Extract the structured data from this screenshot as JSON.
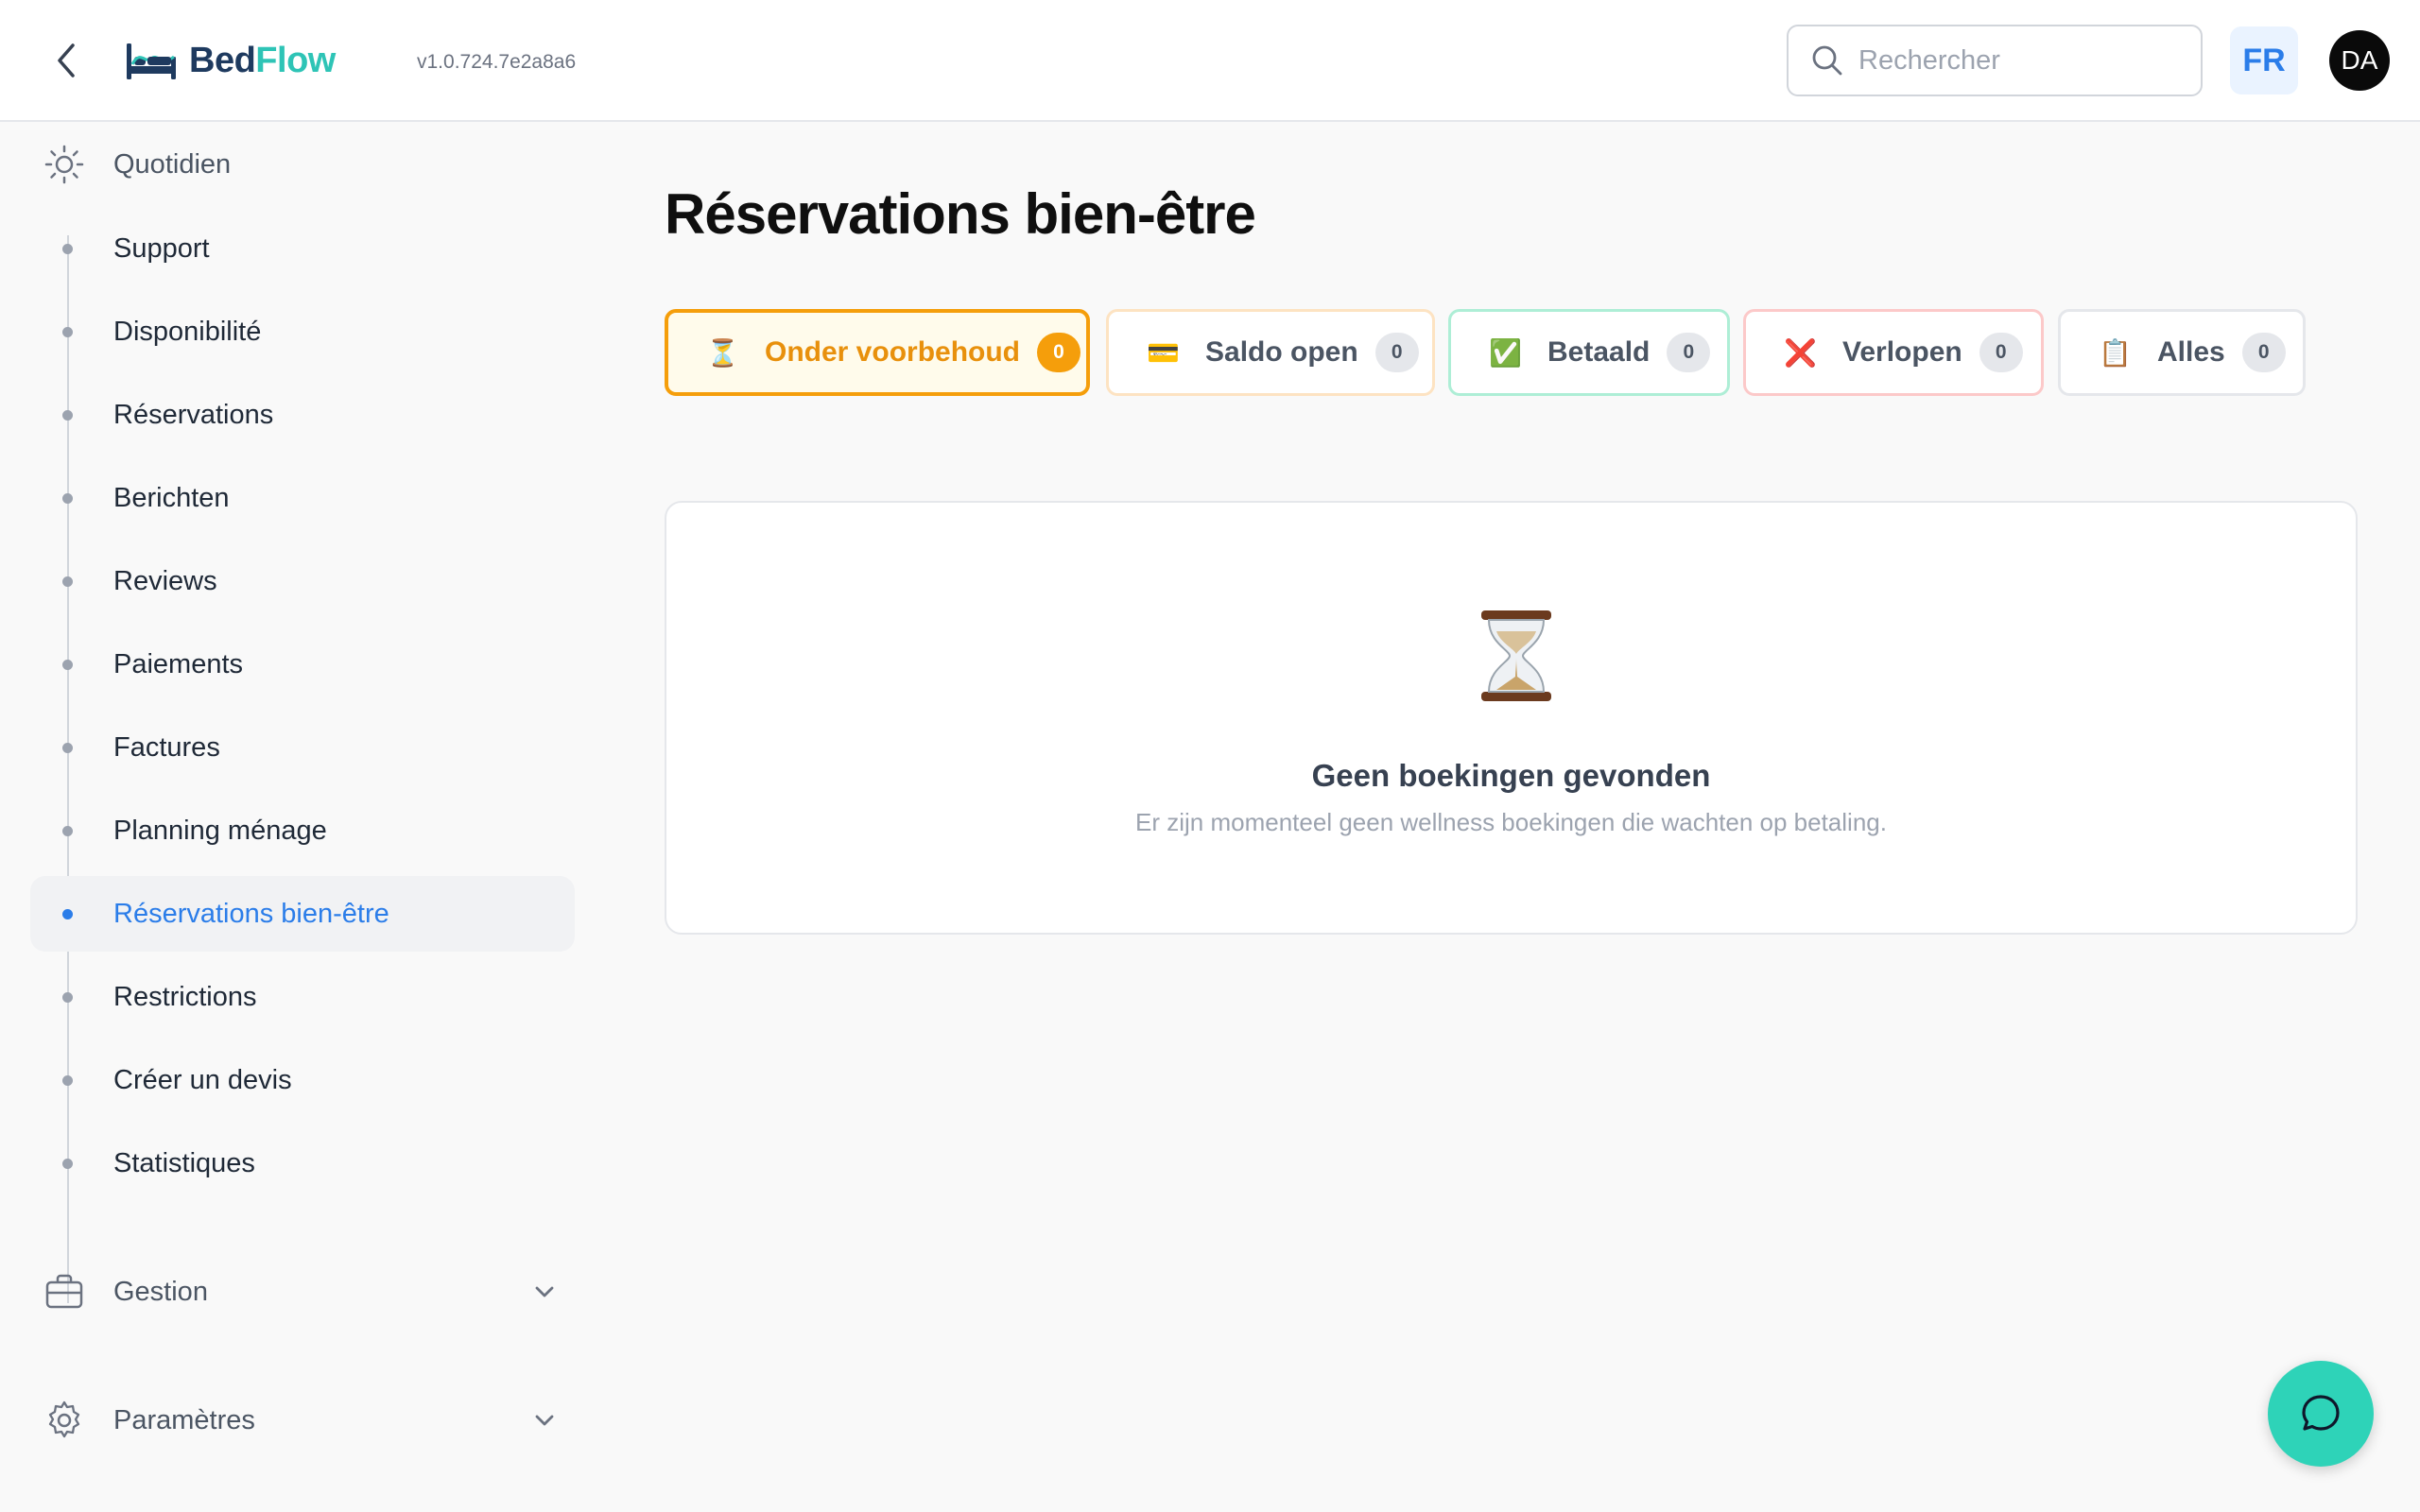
{
  "header": {
    "logo": {
      "part1": "Bed",
      "part2": "Flow"
    },
    "version": "v1.0.724.7e2a8a6",
    "search_placeholder": "Rechercher",
    "language": "FR",
    "avatar_initials": "DA"
  },
  "sidebar": {
    "section_daily": "Quotidien",
    "items": [
      {
        "label": "Support"
      },
      {
        "label": "Disponibilité"
      },
      {
        "label": "Réservations"
      },
      {
        "label": "Berichten"
      },
      {
        "label": "Reviews"
      },
      {
        "label": "Paiements"
      },
      {
        "label": "Factures"
      },
      {
        "label": "Planning ménage"
      },
      {
        "label": "Réservations bien-être",
        "active": true
      },
      {
        "label": "Restrictions"
      },
      {
        "label": "Créer un devis"
      },
      {
        "label": "Statistiques"
      }
    ],
    "section_management": "Gestion",
    "section_settings": "Paramètres"
  },
  "main": {
    "title": "Réservations bien-être",
    "tabs": [
      {
        "emoji": "⏳",
        "label": "Onder voorbehoud",
        "count": "0",
        "active": true
      },
      {
        "emoji": "💳",
        "label": "Saldo open",
        "count": "0"
      },
      {
        "emoji": "✅",
        "label": "Betaald",
        "count": "0"
      },
      {
        "emoji": "❌",
        "label": "Verlopen",
        "count": "0"
      },
      {
        "emoji": "📋",
        "label": "Alles",
        "count": "0"
      }
    ],
    "empty": {
      "icon": "hourglass-icon",
      "title": "Geen boekingen gevonden",
      "subtitle": "Er zijn momenteel geen wellness boekingen die wachten op betaling."
    }
  },
  "colors": {
    "accent_blue": "#2b7de9",
    "brand_teal": "#2ec4b6",
    "pending_orange": "#f59e0b",
    "chat_button": "#2ed3b8"
  }
}
